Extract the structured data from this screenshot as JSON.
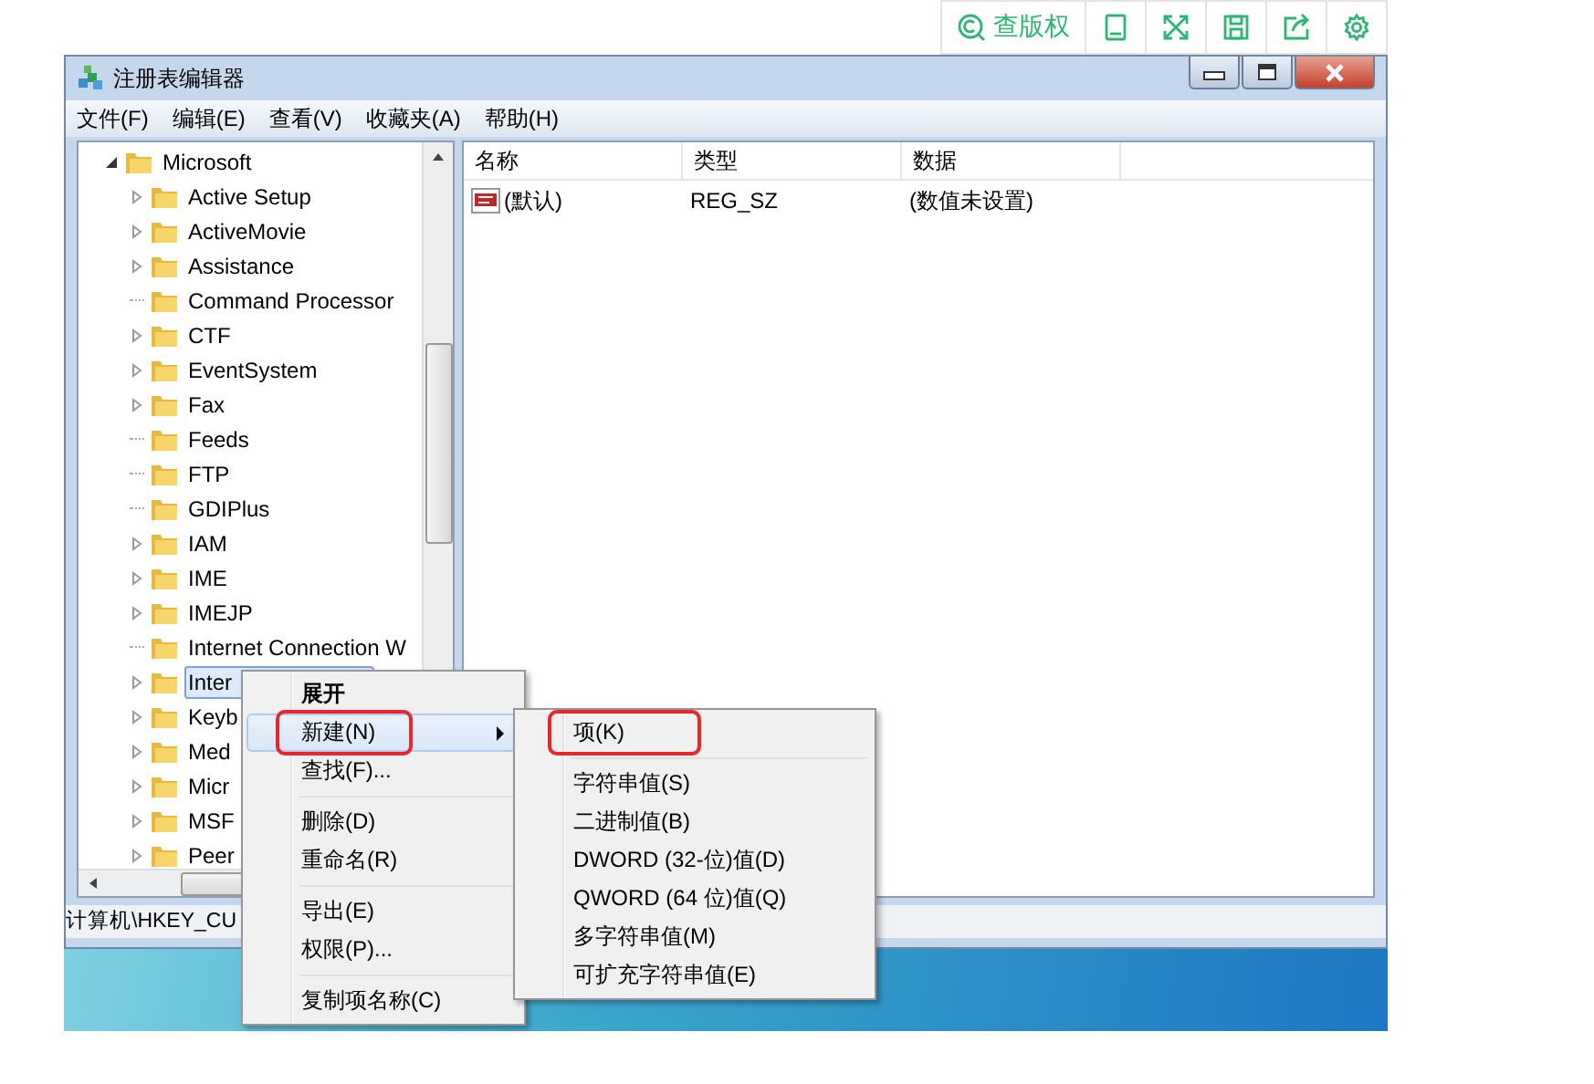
{
  "toolbar": {
    "copyright_label": "查版权"
  },
  "window": {
    "title": "注册表编辑器"
  },
  "menu": [
    "文件(F)",
    "编辑(E)",
    "查看(V)",
    "收藏夹(A)",
    "帮助(H)"
  ],
  "tree": [
    {
      "label": "Microsoft",
      "expanded": true,
      "selected": false,
      "children": [
        {
          "label": "Active Setup",
          "has_children": true,
          "selected": false
        },
        {
          "label": "ActiveMovie",
          "has_children": true,
          "selected": false
        },
        {
          "label": "Assistance",
          "has_children": true,
          "selected": false
        },
        {
          "label": "Command Processor",
          "has_children": false,
          "selected": false
        },
        {
          "label": "CTF",
          "has_children": true,
          "selected": false
        },
        {
          "label": "EventSystem",
          "has_children": true,
          "selected": false
        },
        {
          "label": "Fax",
          "has_children": true,
          "selected": false
        },
        {
          "label": "Feeds",
          "has_children": false,
          "selected": false
        },
        {
          "label": "FTP",
          "has_children": false,
          "selected": false
        },
        {
          "label": "GDIPlus",
          "has_children": false,
          "selected": false
        },
        {
          "label": "IAM",
          "has_children": true,
          "selected": false
        },
        {
          "label": "IME",
          "has_children": true,
          "selected": false
        },
        {
          "label": "IMEJP",
          "has_children": true,
          "selected": false
        },
        {
          "label": "Internet Connection W",
          "has_children": false,
          "selected": false
        },
        {
          "label": "Inter",
          "has_children": true,
          "selected": true
        },
        {
          "label": "Keyb",
          "has_children": true,
          "selected": false
        },
        {
          "label": "Med",
          "has_children": true,
          "selected": false
        },
        {
          "label": "Micr",
          "has_children": true,
          "selected": false
        },
        {
          "label": "MSF",
          "has_children": true,
          "selected": false
        },
        {
          "label": "Peer",
          "has_children": true,
          "selected": false
        }
      ]
    }
  ],
  "values": {
    "columns": [
      "名称",
      "类型",
      "数据"
    ],
    "rows": [
      {
        "name": "(默认)",
        "type": "REG_SZ",
        "data": "(数值未设置)"
      }
    ]
  },
  "status_bar": "计算机\\HKEY_CU",
  "context_menu": [
    {
      "kind": "item",
      "label": "展开",
      "default": true,
      "selected": false,
      "marked": false,
      "submenu": false
    },
    {
      "kind": "item",
      "label": "新建(N)",
      "default": false,
      "selected": true,
      "marked": true,
      "submenu": true
    },
    {
      "kind": "item",
      "label": "查找(F)...",
      "default": false,
      "selected": false,
      "marked": false,
      "submenu": false
    },
    {
      "kind": "separator"
    },
    {
      "kind": "item",
      "label": "删除(D)",
      "default": false,
      "selected": false,
      "marked": false,
      "submenu": false
    },
    {
      "kind": "item",
      "label": "重命名(R)",
      "default": false,
      "selected": false,
      "marked": false,
      "submenu": false
    },
    {
      "kind": "separator"
    },
    {
      "kind": "item",
      "label": "导出(E)",
      "default": false,
      "selected": false,
      "marked": false,
      "submenu": false
    },
    {
      "kind": "item",
      "label": "权限(P)...",
      "default": false,
      "selected": false,
      "marked": false,
      "submenu": false
    },
    {
      "kind": "separator"
    },
    {
      "kind": "item",
      "label": "复制项名称(C)",
      "default": false,
      "selected": false,
      "marked": false,
      "submenu": false
    }
  ],
  "submenu": [
    {
      "kind": "item",
      "label": "项(K)",
      "marked": true
    },
    {
      "kind": "separator"
    },
    {
      "kind": "item",
      "label": "字符串值(S)",
      "marked": false
    },
    {
      "kind": "item",
      "label": "二进制值(B)",
      "marked": false
    },
    {
      "kind": "item",
      "label": "DWORD (32-位)值(D)",
      "marked": false
    },
    {
      "kind": "item",
      "label": "QWORD (64 位)值(Q)",
      "marked": false
    },
    {
      "kind": "item",
      "label": "多字符串值(M)",
      "marked": false
    },
    {
      "kind": "item",
      "label": "可扩充字符串值(E)",
      "marked": false
    }
  ]
}
